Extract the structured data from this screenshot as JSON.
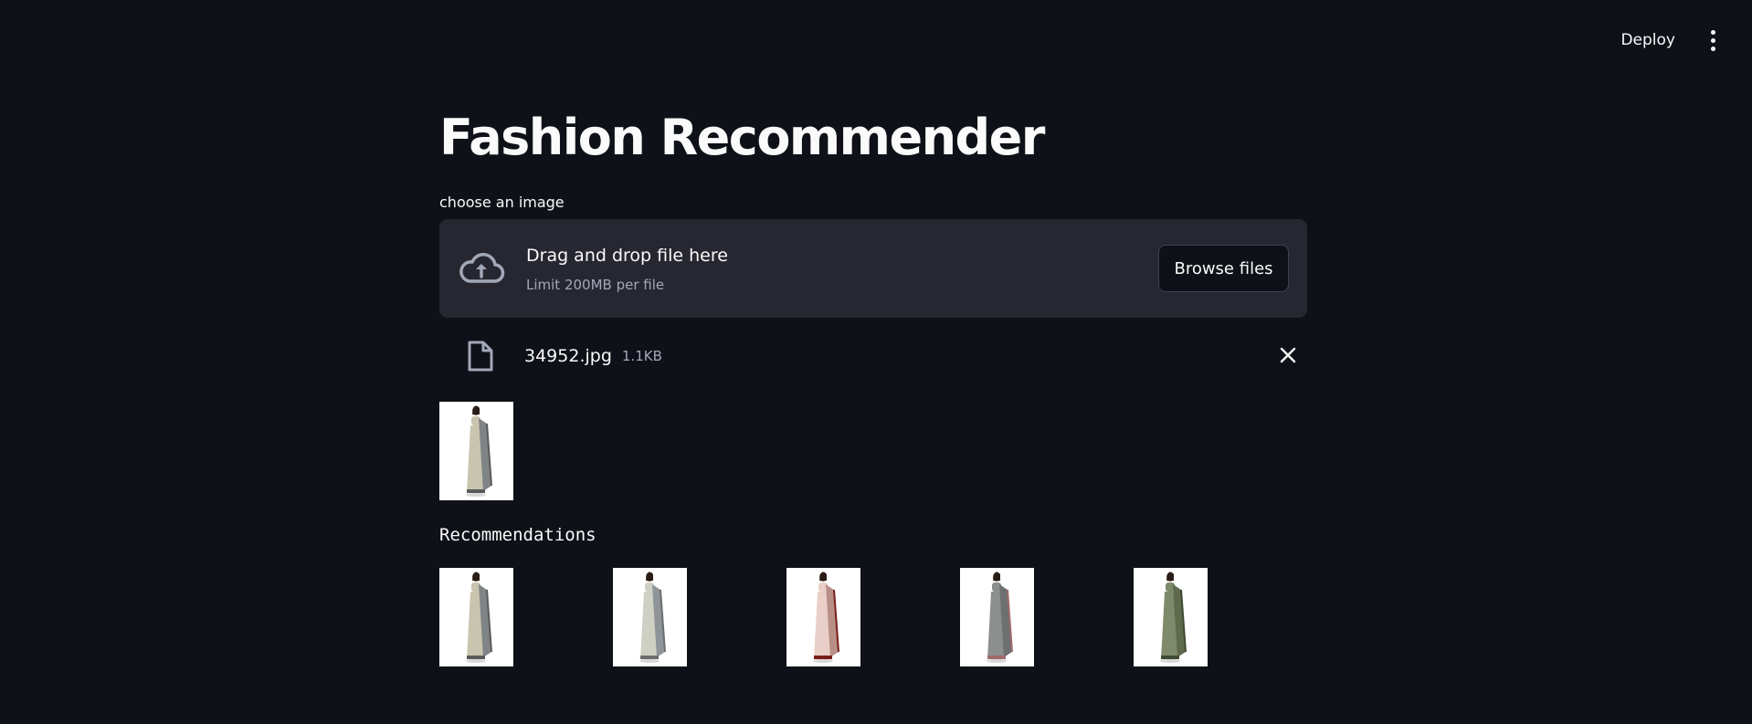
{
  "header": {
    "deploy_label": "Deploy",
    "menu_icon": "kebab-menu-icon"
  },
  "page": {
    "title": "Fashion Recommender"
  },
  "uploader": {
    "label": "choose an image",
    "drop_text": "Drag and drop file here",
    "limit_text": "Limit 200MB per file",
    "browse_label": "Browse files",
    "icon": "cloud-upload-icon"
  },
  "uploaded_file": {
    "name": "34952.jpg",
    "size": "1.1KB",
    "icon": "file-icon",
    "remove_icon": "close-icon"
  },
  "recommendations": {
    "heading": "Recommendations",
    "items": [
      {
        "saree_color": "#c9c4ae",
        "drape_color": "#7f8487",
        "border_color": "#5a5a5a"
      },
      {
        "saree_color": "#cfd0c4",
        "drape_color": "#8e9498",
        "border_color": "#6a6e70"
      },
      {
        "saree_color": "#e9cfc8",
        "drape_color": "#b88f86",
        "border_color": "#7a1e1a"
      },
      {
        "saree_color": "#8d8f8e",
        "drape_color": "#6d6f70",
        "border_color": "#a06a6a"
      },
      {
        "saree_color": "#7f8a6a",
        "drape_color": "#5f6a4c",
        "border_color": "#3f4a34"
      }
    ]
  },
  "query_image": {
    "saree_color": "#c9c4ae",
    "drape_color": "#7f8487",
    "border_color": "#5a5a5a"
  }
}
